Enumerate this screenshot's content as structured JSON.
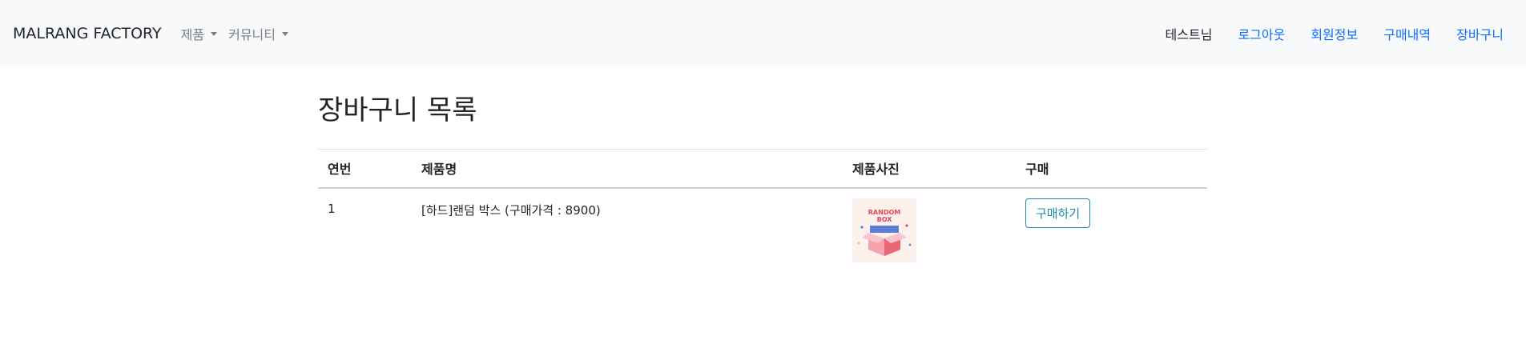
{
  "navbar": {
    "brand": "MALRANG FACTORY",
    "dropdowns": [
      {
        "label": "제품"
      },
      {
        "label": "커뮤니티"
      }
    ],
    "user_label": "테스트님",
    "links": [
      {
        "label": "로그아웃"
      },
      {
        "label": "회원정보"
      },
      {
        "label": "구매내역"
      },
      {
        "label": "장바구니"
      }
    ],
    "link_color": "#0d6efd"
  },
  "page": {
    "title": "장바구니 목록"
  },
  "table": {
    "headers": [
      "연번",
      "제품명",
      "제품사진",
      "구매"
    ],
    "rows": [
      {
        "no": "1",
        "name": "[하드]랜덤 박스 (구매가격 : 8900)",
        "image_label": "RANDOM BOX",
        "button_label": "구매하기"
      }
    ]
  }
}
